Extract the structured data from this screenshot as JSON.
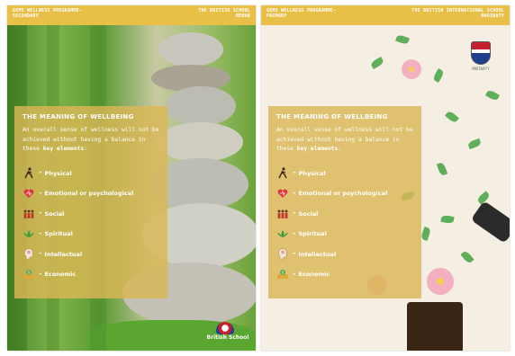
{
  "left_poster": {
    "header_left": [
      "GEMS WELLNESS PROGRAMME-",
      "SECONDARY"
    ],
    "header_right": [
      "THE BRITISH SCHOOL",
      "REHAB"
    ],
    "title": "THE MEANING OF WELLBEING",
    "intro_before": "An overall sense of wellness will not be achieved without having a balance in these ",
    "intro_bold": "key elements",
    "intro_after": ":",
    "items": [
      {
        "label": "Physical",
        "icon": "running-figure-icon"
      },
      {
        "label": "Emotional or psychological",
        "icon": "heart-icon"
      },
      {
        "label": "Social",
        "icon": "people-icon"
      },
      {
        "label": "Spiritual",
        "icon": "lotus-icon"
      },
      {
        "label": "Intellectual",
        "icon": "head-brain-icon"
      },
      {
        "label": "Economic",
        "icon": "money-icon"
      }
    ],
    "logo_text": "British School"
  },
  "right_poster": {
    "header_left": [
      "GEMS WELLNESS PROGRAMME-",
      "PRIMARY"
    ],
    "header_right": [
      "THE BRITISH INTERNATIONAL SCHOOL",
      "MADINATY"
    ],
    "title": "THE MEANING OF WELLBEING",
    "intro_before": "An overall sense of wellness will not be achieved without having a balance in these ",
    "intro_bold": "key elements",
    "intro_after": ":",
    "items": [
      {
        "label": "Physical",
        "icon": "running-figure-icon"
      },
      {
        "label": "Emotional or psychological",
        "icon": "heart-icon"
      },
      {
        "label": "Social",
        "icon": "people-icon"
      },
      {
        "label": "Spiritual",
        "icon": "lotus-icon"
      },
      {
        "label": "Intellectual",
        "icon": "head-brain-icon"
      },
      {
        "label": "Economic",
        "icon": "money-icon"
      }
    ],
    "logo_caption": "MADINATY"
  },
  "colors": {
    "header_bar": "#e8c048",
    "panel": "#dbb756",
    "text": "#ffffff",
    "heart": "#e2343c",
    "lotus": "#3f9a3a"
  }
}
